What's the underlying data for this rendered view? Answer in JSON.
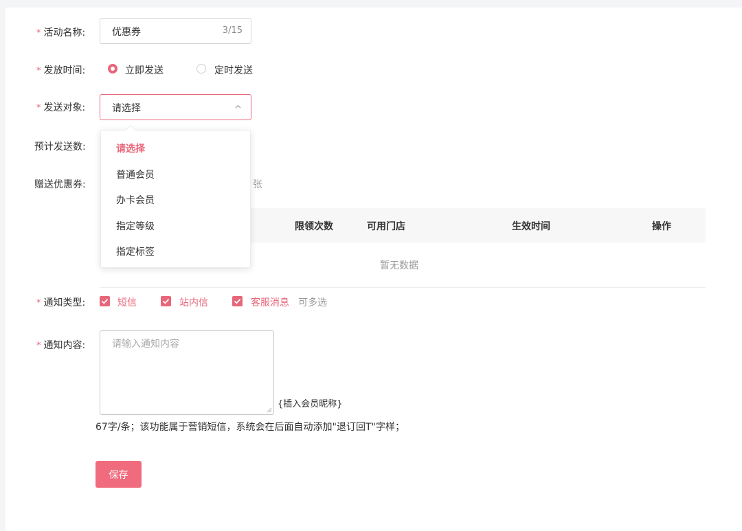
{
  "form": {
    "activity_name": {
      "label": "活动名称:",
      "value": "优惠券",
      "counter": "3/15"
    },
    "send_time": {
      "label": "发放时间:",
      "options": [
        {
          "label": "立即发送",
          "selected": true
        },
        {
          "label": "定时发送",
          "selected": false
        }
      ]
    },
    "send_target": {
      "label": "发送对象:",
      "value": "请选择",
      "dropdown": [
        "请选择",
        "普通会员",
        "办卡会员",
        "指定等级",
        "指定标签"
      ]
    },
    "estimated_count": {
      "label": "预计发送数:"
    },
    "gift_coupon": {
      "label": "赠送优惠券:",
      "unit": "张",
      "columns": [
        "限领次数",
        "可用门店",
        "生效时间",
        "操作"
      ],
      "empty_text": "暂无数据"
    },
    "notify_type": {
      "label": "通知类型:",
      "options": [
        "短信",
        "站内信",
        "客服消息"
      ],
      "hint": "可多选"
    },
    "notify_content": {
      "label": "通知内容:",
      "placeholder": "请输入通知内容",
      "insert_link": "{插入会员昵称}",
      "tip": "67字/条；该功能属于营销短信，系统会在后面自动添加\"退订回T\"字样；"
    },
    "save_label": "保存"
  },
  "colors": {
    "accent": "#e8667a",
    "button": "#f06b7e"
  }
}
